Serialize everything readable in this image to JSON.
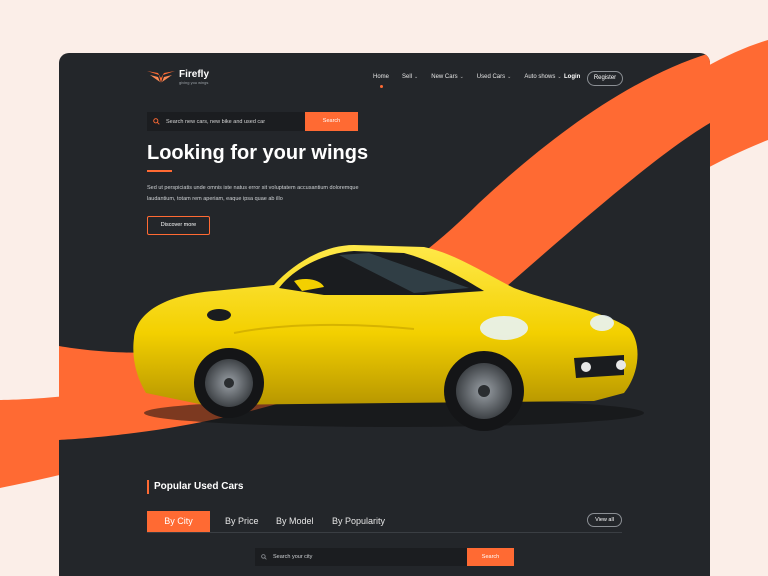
{
  "brand": {
    "name": "Firefly",
    "tagline": "giving you wings",
    "accent": "#ff6a33",
    "card_bg": "#23262a",
    "page_bg": "#fbeee8",
    "car_color": "#f3d000"
  },
  "nav": {
    "items": [
      {
        "label": "Home",
        "active": true,
        "dropdown": false
      },
      {
        "label": "Sell",
        "active": false,
        "dropdown": true
      },
      {
        "label": "New Cars",
        "active": false,
        "dropdown": true
      },
      {
        "label": "Used Cars",
        "active": false,
        "dropdown": true
      },
      {
        "label": "Auto shows",
        "active": false,
        "dropdown": true
      }
    ],
    "chevron": "⌄",
    "login_label": "Login",
    "register_label": "Register"
  },
  "search": {
    "placeholder": "Search new cars, new bike and used car",
    "button_label": "Search",
    "icon": "search-icon"
  },
  "hero": {
    "title": "Looking for your wings",
    "description": "Sed ut perspiciatis unde omnis iste natus error sit voluptatem accusantium doloremque laudantium, totam rem aperiam, eaque ipsa quae ab illo",
    "cta_label": "Discover more"
  },
  "popular": {
    "title": "Popular Used Cars",
    "tabs": [
      {
        "label": "By City",
        "active": true
      },
      {
        "label": "By Price",
        "active": false
      },
      {
        "label": "By Model",
        "active": false
      },
      {
        "label": "By Popularity",
        "active": false
      }
    ],
    "view_all_label": "View all",
    "city_search_placeholder": "Search your city",
    "city_search_button": "Search"
  }
}
